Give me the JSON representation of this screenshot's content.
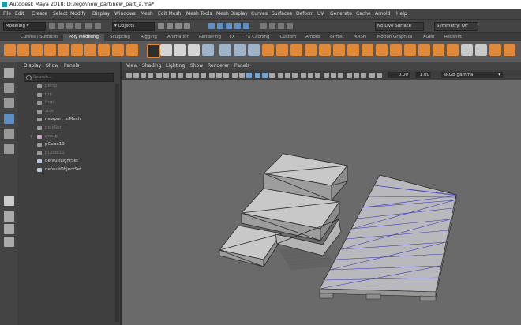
{
  "window": {
    "title": "Autodesk Maya 2018: D:\\lego\\new_part\\new_part_a.ma*"
  },
  "menu": [
    "File",
    "Edit",
    "Create",
    "Select",
    "Modify",
    "Display",
    "Windows",
    "Mesh",
    "Edit Mesh",
    "Mesh Tools",
    "Mesh Display",
    "Curves",
    "Surfaces",
    "Deform",
    "UV",
    "Generate",
    "Cache",
    "Arnold",
    "Help"
  ],
  "status": {
    "mode": "Modeling",
    "objects_label": "Objects",
    "live_surface": "No Live Surface",
    "symmetry": "Symmetry: Off"
  },
  "shelf_tabs": [
    "Curves / Surfaces",
    "Poly Modeling",
    "Sculpting",
    "Rigging",
    "Animation",
    "Rendering",
    "FX",
    "FX Caching",
    "Custom",
    "Arnold",
    "Bifrost",
    "MASH",
    "Motion Graphics",
    "XGen",
    "Redshift"
  ],
  "active_shelf_tab": "Poly Modeling",
  "outliner": {
    "menu": [
      "Display",
      "Show",
      "Panels"
    ],
    "search_placeholder": "Search...",
    "items": [
      {
        "label": "persp",
        "dim": true,
        "icon": "camera-icon"
      },
      {
        "label": "top",
        "dim": true,
        "icon": "camera-icon"
      },
      {
        "label": "front",
        "dim": true,
        "icon": "camera-icon"
      },
      {
        "label": "side",
        "dim": true,
        "icon": "camera-icon"
      },
      {
        "label": "newpart_a:Mesh",
        "dim": false,
        "icon": "mesh-icon"
      },
      {
        "label": "polySur",
        "dim": true,
        "icon": "mesh-icon"
      },
      {
        "label": "group",
        "dim": true,
        "icon": "group-icon"
      },
      {
        "label": "pCube10",
        "dim": false,
        "icon": "mesh-icon"
      },
      {
        "label": "pCube11",
        "dim": true,
        "icon": "mesh-icon"
      },
      {
        "label": "defaultLightSet",
        "dim": false,
        "icon": "set-icon"
      },
      {
        "label": "defaultObjectSet",
        "dim": false,
        "icon": "set-icon"
      }
    ]
  },
  "viewport": {
    "menu": [
      "View",
      "Shading",
      "Lighting",
      "Show",
      "Renderer",
      "Panels"
    ],
    "exposure": "0.00",
    "gamma": "1.00",
    "color_space": "sRGB gamma"
  },
  "colors": {
    "accent": "#5d8fc4",
    "shelf_icon": "#e1893a",
    "viewport_bg": "#6a6a6a",
    "panel": "#444444"
  }
}
